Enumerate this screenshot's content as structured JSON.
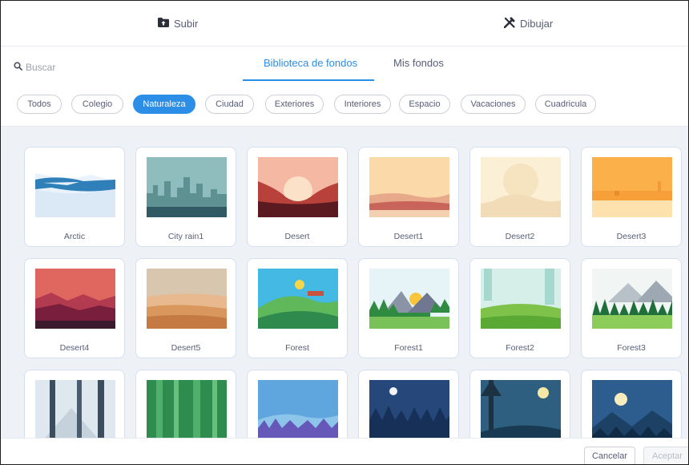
{
  "toolbar": {
    "upload_label": "Subir",
    "draw_label": "Dibujar"
  },
  "search": {
    "placeholder": "Buscar"
  },
  "tabs": [
    {
      "label": "Biblioteca de fondos",
      "active": true
    },
    {
      "label": "Mis fondos",
      "active": false
    }
  ],
  "categories": [
    {
      "label": "Todos"
    },
    {
      "label": "Colegio"
    },
    {
      "label": "Naturaleza",
      "selected": true
    },
    {
      "label": "Ciudad"
    },
    {
      "label": "Exteriores"
    },
    {
      "label": "Interiores"
    },
    {
      "label": "Espacio"
    },
    {
      "label": "Vacaciones"
    },
    {
      "label": "Cuadricula"
    }
  ],
  "backdrops": [
    "Arctic",
    "City rain1",
    "Desert",
    "Desert1",
    "Desert2",
    "Desert3",
    "Desert4",
    "Desert5",
    "Forest",
    "Forest1",
    "Forest2",
    "Forest3",
    "",
    "",
    "",
    "",
    "",
    ""
  ],
  "footer": {
    "cancel_label": "Cancelar",
    "accept_label": "Aceptar"
  },
  "colors": {
    "accent": "#2c8ee6",
    "text": "#575e75",
    "grid_background": "#eef2f7"
  }
}
